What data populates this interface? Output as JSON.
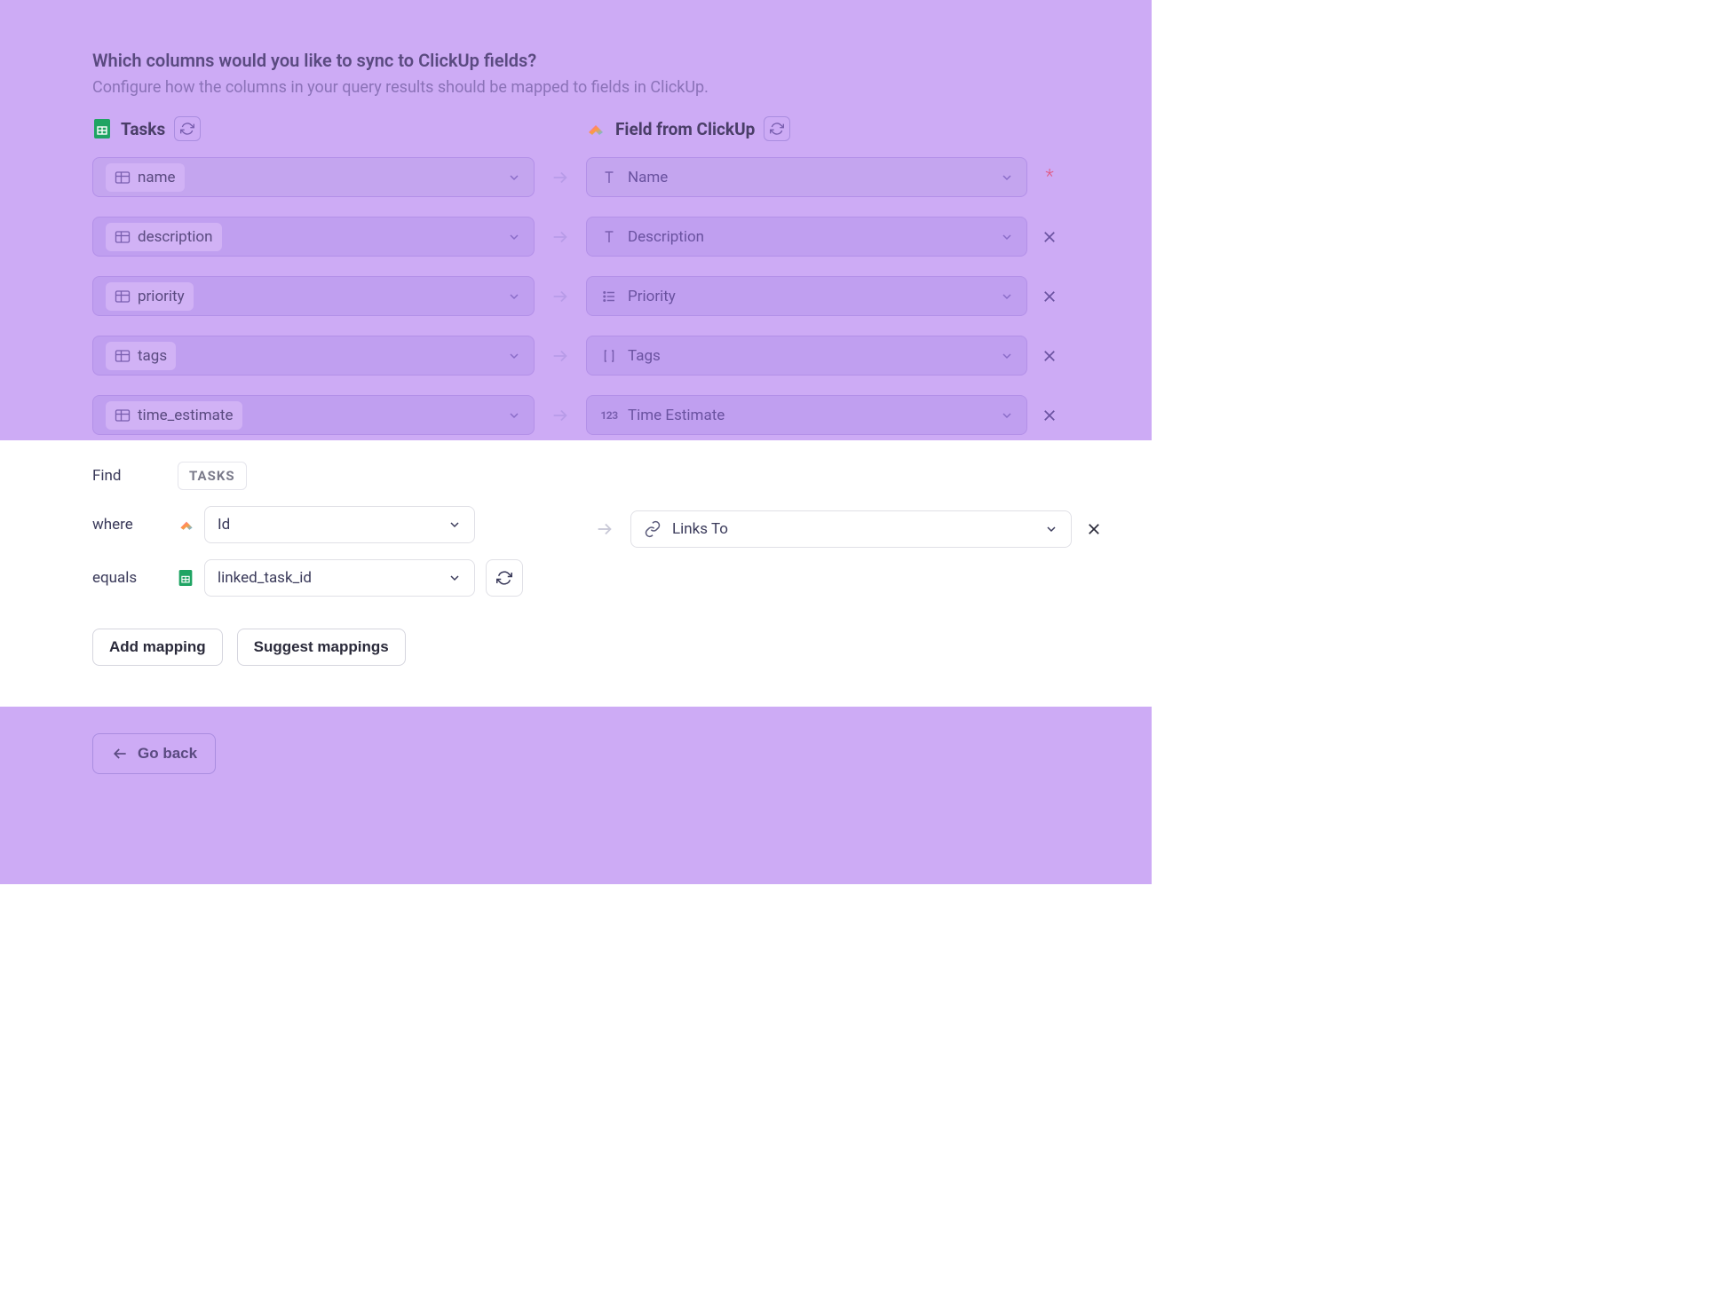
{
  "header": {
    "question": "Which columns would you like to sync to ClickUp fields?",
    "subtitle": "Configure how the columns in your query results should be mapped to fields in ClickUp."
  },
  "columns": {
    "left_title": "Tasks",
    "right_title": "Field from ClickUp"
  },
  "mappings": [
    {
      "source": "name",
      "target": "Name",
      "target_type": "text",
      "required": true,
      "disabled": true
    },
    {
      "source": "description",
      "target": "Description",
      "target_type": "text",
      "required": false,
      "disabled": false
    },
    {
      "source": "priority",
      "target": "Priority",
      "target_type": "list",
      "required": false,
      "disabled": false
    },
    {
      "source": "tags",
      "target": "Tags",
      "target_type": "array",
      "required": false,
      "disabled": false
    },
    {
      "source": "time_estimate",
      "target": "Time Estimate",
      "target_type": "number",
      "required": false,
      "disabled": false
    }
  ],
  "lookup": {
    "find_label": "Find",
    "find_value": "TASKS",
    "where_label": "where",
    "where_value": "Id",
    "equals_label": "equals",
    "equals_value": "linked_task_id",
    "target": "Links To"
  },
  "buttons": {
    "add_mapping": "Add mapping",
    "suggest_mappings": "Suggest mappings",
    "go_back": "Go back"
  }
}
